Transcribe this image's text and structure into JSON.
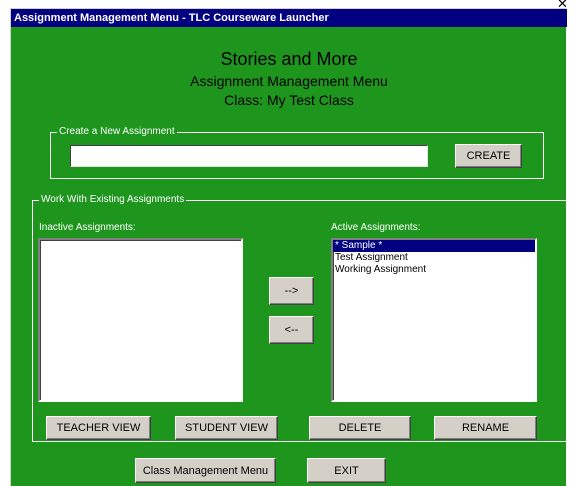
{
  "window": {
    "title": "Assignment Management Menu - TLC Courseware Launcher"
  },
  "header": {
    "title": "Stories and More",
    "subtitle": "Assignment Management Menu",
    "class_line": "Class: My Test Class"
  },
  "create_group": {
    "label": "Create a New Assignment",
    "input_value": "",
    "create_button": "CREATE"
  },
  "existing_group": {
    "label": "Work With Existing Assignments",
    "inactive_label": "Inactive Assignments:",
    "active_label": "Active Assignments:",
    "inactive_items": [],
    "active_items": [
      "* Sample *",
      "Test Assignment",
      "Working Assignment"
    ],
    "selected_active": "* Sample *",
    "move_right_button": "-->",
    "move_left_button": "<--",
    "teacher_view_button": "TEACHER VIEW",
    "student_view_button": "STUDENT VIEW",
    "delete_button": "DELETE",
    "rename_button": "RENAME"
  },
  "footer": {
    "class_menu_button": "Class Management Menu",
    "exit_button": "EXIT"
  },
  "colors": {
    "window_bg": "#1e961e",
    "titlebar_bg": "#000080",
    "selection_bg": "#000080",
    "button_face": "#d4d0c8"
  },
  "icons": {
    "close": "close-icon"
  }
}
